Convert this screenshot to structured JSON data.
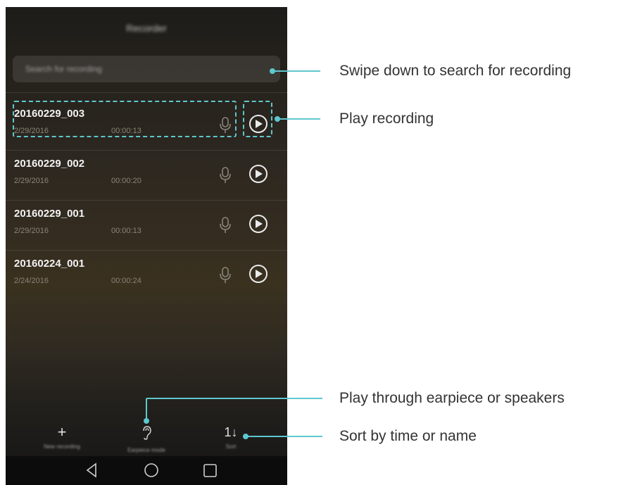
{
  "app": {
    "title": "Recorder"
  },
  "search": {
    "placeholder": "Search for recording"
  },
  "recordings": [
    {
      "name": "20160229_003",
      "date": "2/29/2016",
      "duration": "00:00:13"
    },
    {
      "name": "20160229_002",
      "date": "2/29/2016",
      "duration": "00:00:20"
    },
    {
      "name": "20160229_001",
      "date": "2/29/2016",
      "duration": "00:00:13"
    },
    {
      "name": "20160224_001",
      "date": "2/24/2016",
      "duration": "00:00:24"
    }
  ],
  "bottom_bar": {
    "new_recording": {
      "icon": "plus-icon",
      "label": "New recording"
    },
    "earpiece_mode": {
      "icon": "ear-icon",
      "label": "Earpiece mode"
    },
    "sort": {
      "icon": "sort-icon",
      "label": "Sort"
    }
  },
  "callouts": {
    "search": "Swipe down to search for recording",
    "play": "Play recording",
    "earpiece": "Play through earpiece or speakers",
    "sort": "Sort by time or name"
  },
  "colors": {
    "accent": "#5fc7cf"
  }
}
